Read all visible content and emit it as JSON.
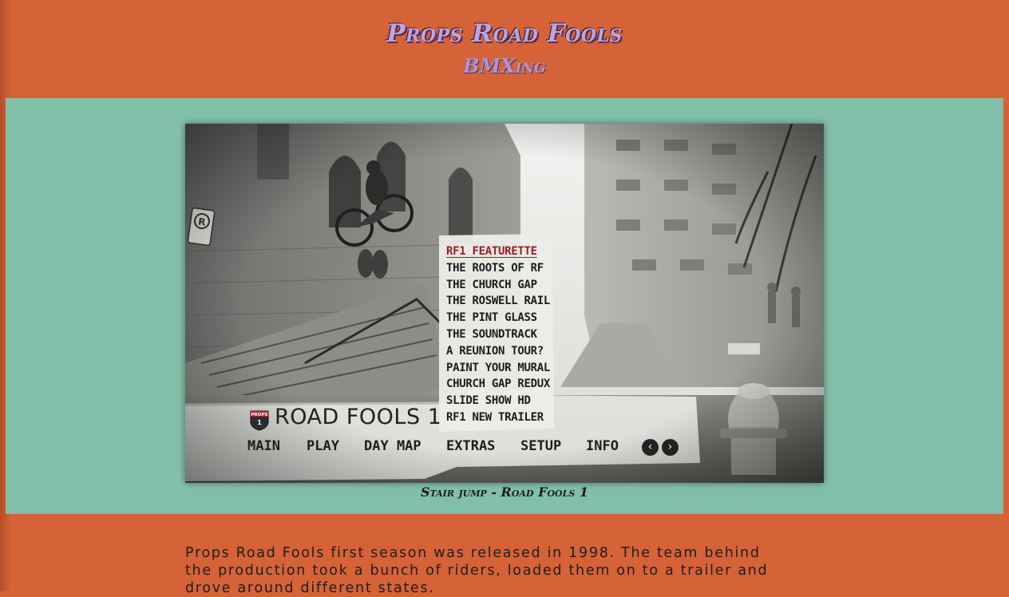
{
  "header": {
    "title": "Props Road Fools",
    "subtitle": "BMXing"
  },
  "dvd_menu": {
    "sign_text": "R",
    "badge_label": "PROPS",
    "logo_title": "ROAD FOOLS 1",
    "menu_items": [
      "RF1 FEATURETTE",
      "THE ROOTS OF RF",
      "THE CHURCH GAP",
      "THE ROSWELL RAIL",
      "THE PINT GLASS",
      "THE SOUNDTRACK",
      "A REUNION TOUR?",
      "PAINT YOUR MURAL",
      "CHURCH GAP REDUX",
      "SLIDE SHOW HD",
      "RF1 NEW TRAILER"
    ],
    "nav": [
      "MAIN",
      "PLAY",
      "DAY MAP",
      "EXTRAS",
      "SETUP",
      "INFO"
    ],
    "prev_glyph": "‹",
    "next_glyph": "›"
  },
  "caption": "Stair jump - Road Fools 1",
  "body": {
    "paragraph": "Props Road Fools first season was released in 1998. The team behind the production took a bunch of riders, loaded them on to a trailer and drove around different states."
  },
  "colors": {
    "page_bg": "#d66238",
    "band_bg": "#82bfa9",
    "title_color": "#b8a6e0",
    "active_menu": "#9a1d20"
  }
}
